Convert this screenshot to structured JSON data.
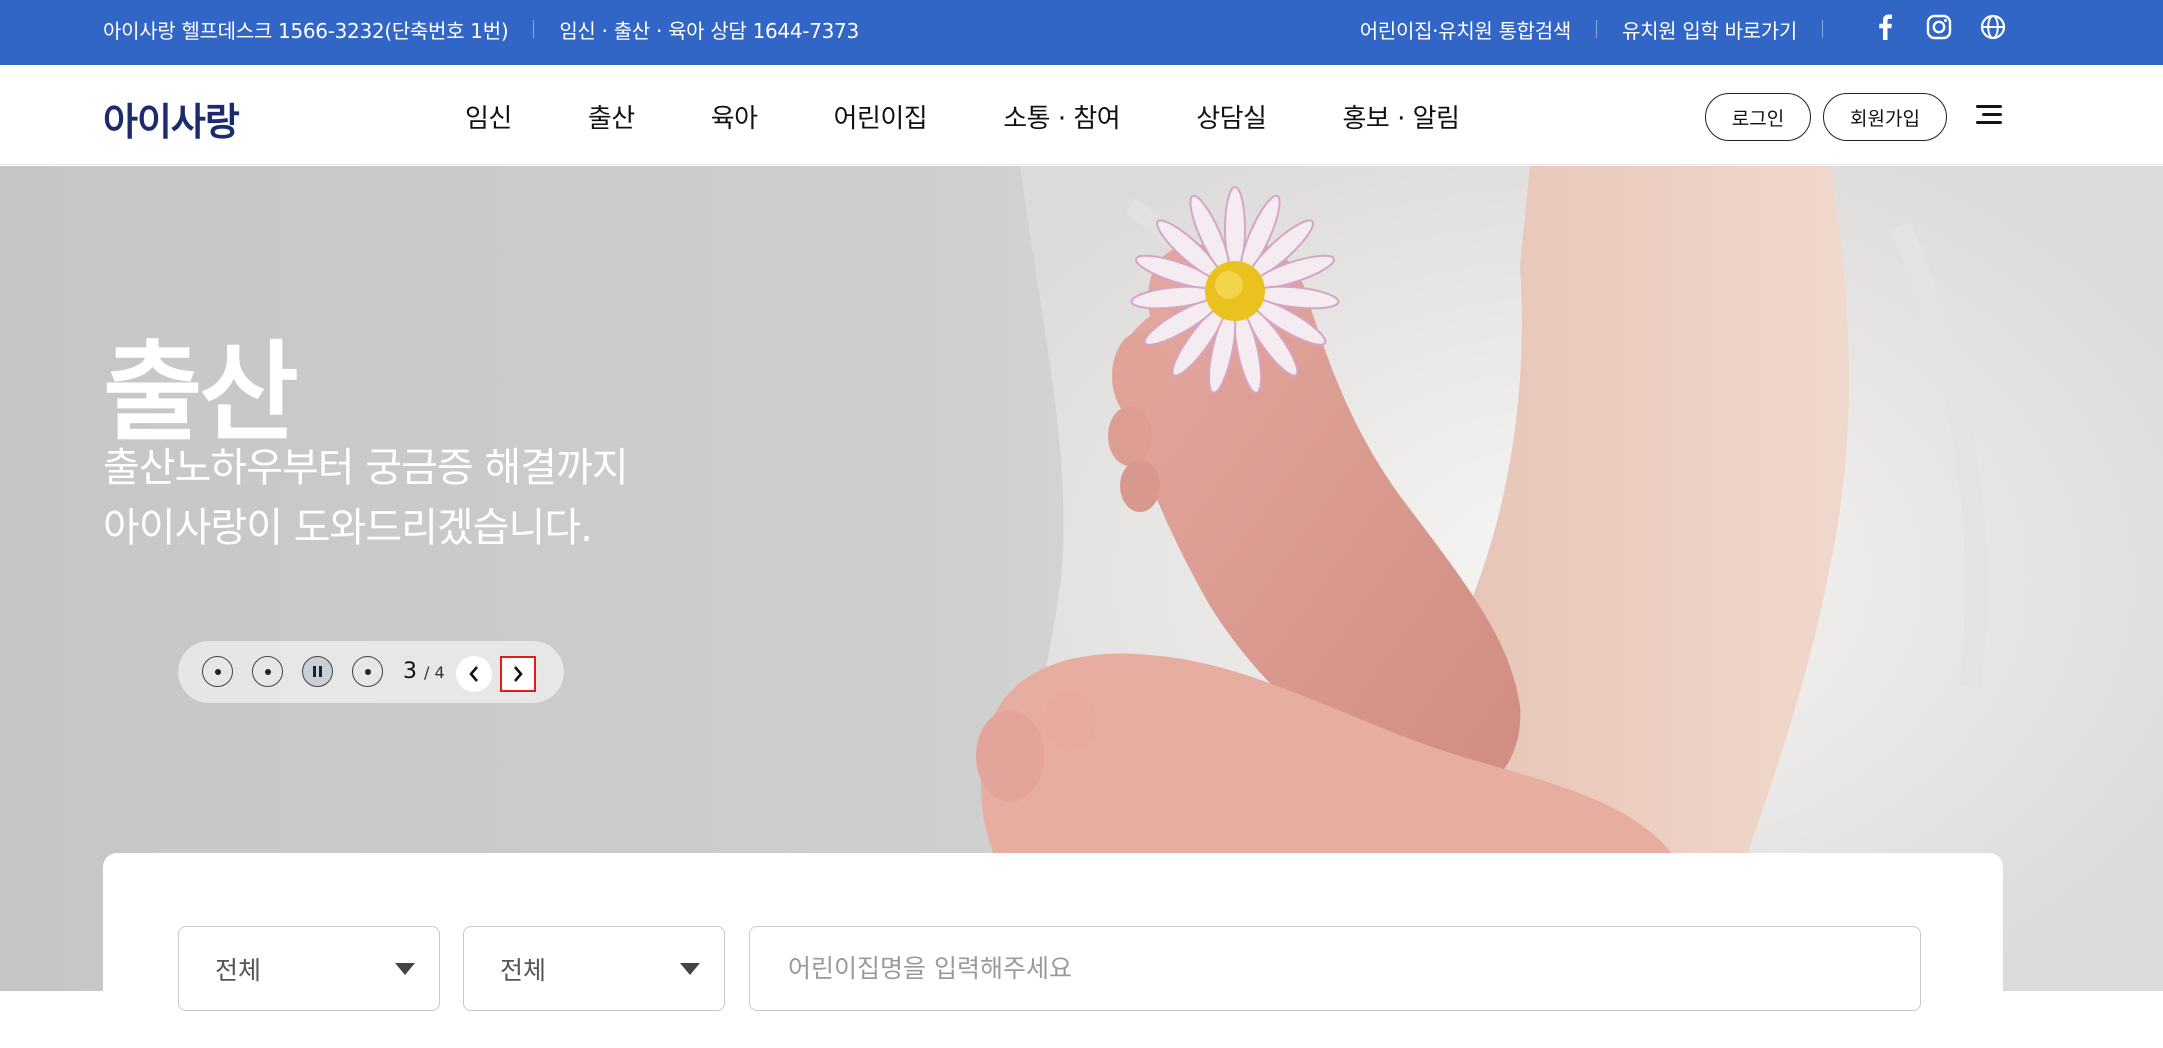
{
  "topbar": {
    "helpdesk": "아이사랑 헬프데스크 1566-3232(단축번호 1번)",
    "consult": "임신 · 출산 · 육아 상담 1644-7373",
    "integrated_search": "어린이집·유치원 통합검색",
    "kindergarten_link": "유치원 입학 바로가기",
    "icons": [
      "facebook-icon",
      "instagram-icon",
      "globe-icon"
    ],
    "bg_color": "#3165c6"
  },
  "header": {
    "logo": "아이사랑",
    "nav": [
      "임신",
      "출산",
      "육아",
      "어린이집",
      "소통 · 참여",
      "상담실",
      "홍보 · 알림"
    ],
    "login": "로그인",
    "signup": "회원가입"
  },
  "hero": {
    "title": "출산",
    "subtitle_line1": "출산노하우부터 궁금증 해결까지",
    "subtitle_line2": "아이사랑이 도와드리겠습니다.",
    "current_slide": "3",
    "total_slides": "/ 4"
  },
  "search": {
    "select1": "전체",
    "select2": "전체",
    "placeholder": "어린이집명을 입력해주세요"
  }
}
